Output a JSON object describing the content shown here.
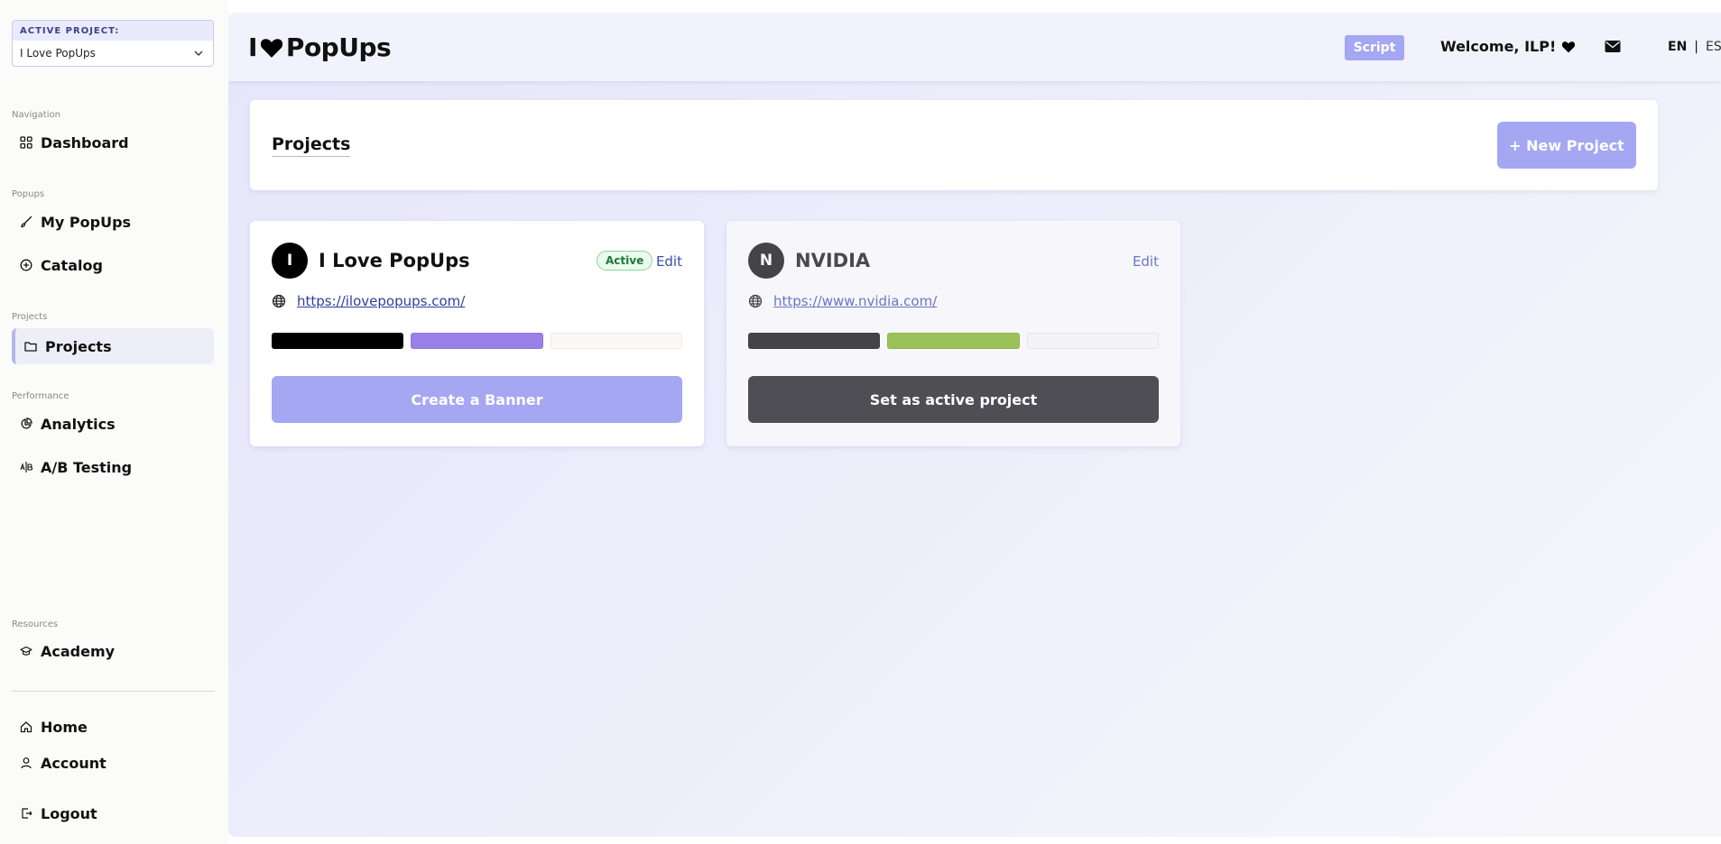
{
  "sidebar": {
    "active_project_label": "ACTIVE PROJECT:",
    "active_project_value": "I Love PopUps",
    "sections": {
      "navigation": "Navigation",
      "popups": "Popups",
      "projects": "Projects",
      "performance": "Performance",
      "resources": "Resources"
    },
    "items": {
      "dashboard": "Dashboard",
      "my_popups": "My PopUps",
      "catalog": "Catalog",
      "projects": "Projects",
      "analytics": "Analytics",
      "ab_testing": "A/B Testing",
      "academy": "Academy",
      "home": "Home",
      "account": "Account",
      "logout": "Logout"
    },
    "active_item": "projects"
  },
  "header": {
    "logo_left": "I",
    "logo_right": "PopUps",
    "script_label": "Script",
    "welcome": "Welcome, ILP!",
    "lang_en": "EN",
    "lang_sep": "|",
    "lang_es": "ES"
  },
  "projects_page": {
    "title": "Projects",
    "new_project_label": "+ New Project"
  },
  "cards": [
    {
      "initial": "I",
      "name": "I Love PopUps",
      "badge": "Active",
      "edit_label": "Edit",
      "url": "https://ilovepopups.com/",
      "colors": [
        "#000000",
        "#9b7fe8",
        "#fbf8f6"
      ],
      "button_label": "Create a Banner"
    },
    {
      "initial": "N",
      "name": "NVIDIA",
      "edit_label": "Edit",
      "url": "https://www.nvidia.com/",
      "colors": [
        "#444448",
        "#9bc25a",
        "#f4f4f8"
      ],
      "button_label": "Set as active project"
    }
  ],
  "colors": {
    "accent": "#a5a7f2",
    "active_badge_text": "#1c7a32",
    "link": "#2f3f9e"
  }
}
